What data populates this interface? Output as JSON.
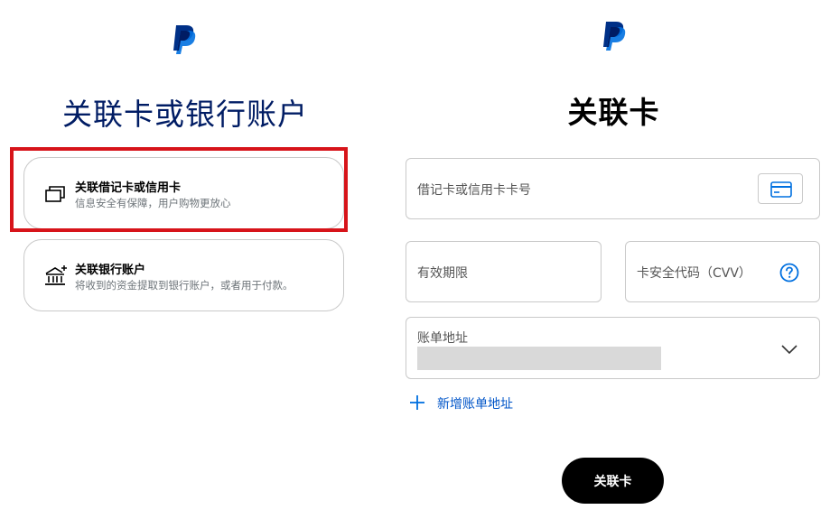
{
  "left": {
    "logo_icon": "paypal-logo",
    "title": "关联卡或银行账户",
    "options": [
      {
        "icon": "cards-icon",
        "title": "关联借记卡或信用卡",
        "desc": "信息安全有保障，用户购物更放心",
        "highlighted": true
      },
      {
        "icon": "bank-add-icon",
        "title": "关联银行账户",
        "desc": "将收到的资金提取到银行账户，或者用于付款。",
        "highlighted": false
      }
    ],
    "highlight_color": "#d7141a"
  },
  "right": {
    "logo_icon": "paypal-logo",
    "title": "关联卡",
    "card_number_label": "借记卡或信用卡卡号",
    "card_button_icon": "credit-card-icon",
    "expiry_label": "有效期限",
    "cvv_label": "卡安全代码（CVV）",
    "cvv_help_icon": "question-circle-icon",
    "billing_label": "账单地址",
    "billing_value_redacted": true,
    "billing_chevron_icon": "chevron-down-icon",
    "add_address_icon": "plus-icon",
    "add_address_label": "新增账单地址",
    "submit_label": "关联卡"
  },
  "colors": {
    "brand_dark": "#003087",
    "brand_light": "#0070e0",
    "link": "#0055c8",
    "button_bg": "#000000"
  }
}
